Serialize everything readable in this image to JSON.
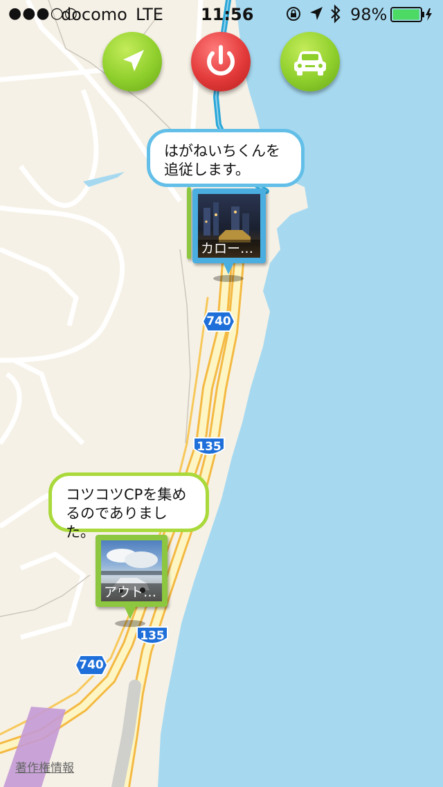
{
  "status_bar": {
    "signal": "●●●○○",
    "carrier": "docomo",
    "network": "LTE",
    "time": "11:56",
    "battery_percent": "98%",
    "battery_level": 0.98
  },
  "controls": {
    "locate_icon": "location-arrow-icon",
    "power_icon": "power-icon",
    "car_icon": "car-icon"
  },
  "markers": [
    {
      "speech": "はがねいちくんを追従します。",
      "caption": "カロー…",
      "color": "#4aaee0"
    },
    {
      "speech": "コツコツCPを集めるのでありました。",
      "caption": "アウト…",
      "color": "#8dc63f"
    }
  ],
  "route_shields": [
    "740",
    "135",
    "135",
    "740"
  ],
  "legal_link": "著作権情報",
  "colors": {
    "sea": "#a6d9f0",
    "land": "#f6f1e6",
    "road": "#f7c85a",
    "route": "#2aa7d8"
  }
}
